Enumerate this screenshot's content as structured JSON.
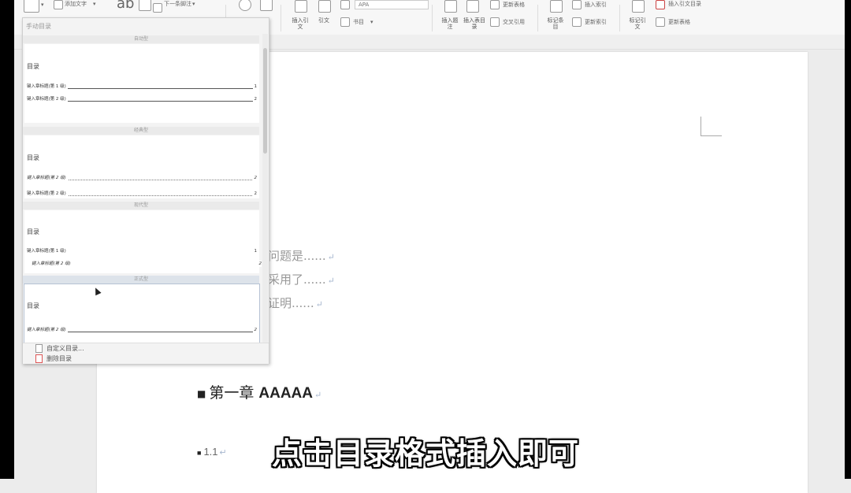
{
  "ribbon": {
    "add_text": "添加文字",
    "next_footnote": "下一条脚注",
    "insert_citation": "插入引文",
    "citation": "引文",
    "style_select": "APA",
    "bibliography": "书目",
    "insert_caption": "插入题注",
    "insert_table_of_figures": "插入表目录",
    "update_table": "更新表格",
    "cross_reference": "交叉引用",
    "mark_entry": "标记条目",
    "insert_index": "插入索引",
    "update_index": "更新索引",
    "mark_citation": "标记引文",
    "insert_table_of_authorities": "插入引文目录",
    "update_table2": "更新表格"
  },
  "dropdown": {
    "header": "手动目录",
    "sections": [
      {
        "label": "自动型",
        "title": "目录",
        "rows": [
          {
            "text": "键入章标题(第 1 级)",
            "num": "1"
          },
          {
            "text": "键入章标题(第 2 级)",
            "num": "2"
          }
        ]
      },
      {
        "label": "经典型",
        "title": "目录",
        "rows": [
          {
            "text": "键入章标题(第 2 级)",
            "num": "2"
          },
          {
            "text": "键入章标题(第 2 级)",
            "num": "2"
          }
        ]
      },
      {
        "label": "现代型",
        "title": "目录",
        "rows": [
          {
            "text": "键入章标题(第 1 级)",
            "num": "1"
          },
          {
            "text": "键入章标题(第 2 级)",
            "num": "2"
          }
        ]
      },
      {
        "label": "正式型",
        "title": "目录",
        "rows": [
          {
            "text": "键入章标题(第 2 级)",
            "num": "2"
          }
        ]
      }
    ],
    "custom_toc": "自定义目录...",
    "delete_toc": "删除目录"
  },
  "document": {
    "lines": [
      "问题是......",
      "采用了......",
      "证明......"
    ],
    "heading1_cn": "第一章 ",
    "heading1_en": "AAAAA",
    "heading2": "1.1"
  },
  "caption": "点击目录格式插入即可"
}
